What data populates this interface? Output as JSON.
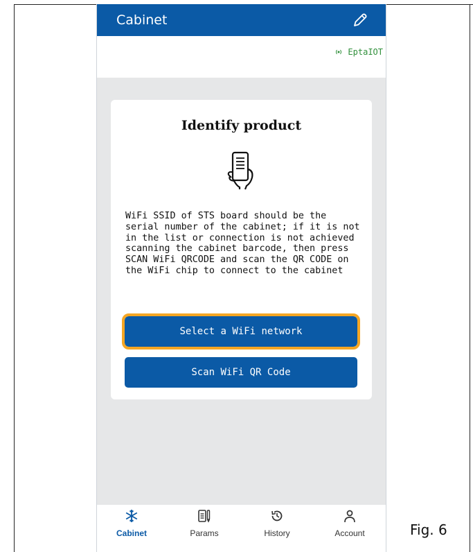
{
  "header": {
    "title": "Cabinet"
  },
  "brand": {
    "name": "EptaIOT"
  },
  "card": {
    "title": "Identify product",
    "description": "WiFi SSID of STS board should be the serial number of the cabinet; if it is not in the list or connection is not achieved scanning the cabinet barcode, then press SCAN WiFi QRCODE and scan the QR CODE on the WiFi chip to connect to the cabinet",
    "select_button": "Select a WiFi network",
    "scan_button": "Scan WiFi QR Code"
  },
  "nav": {
    "items": [
      {
        "label": "Cabinet",
        "icon": "snowflake-icon",
        "active": true
      },
      {
        "label": "Params",
        "icon": "params-icon",
        "active": false
      },
      {
        "label": "History",
        "icon": "history-icon",
        "active": false
      },
      {
        "label": "Account",
        "icon": "user-icon",
        "active": false
      }
    ]
  },
  "figure_label": "Fig. 6",
  "colors": {
    "primary": "#0b5aa6",
    "highlight": "#f5a623",
    "brand_green": "#2f8f3a",
    "background": "#e6e7e8"
  }
}
